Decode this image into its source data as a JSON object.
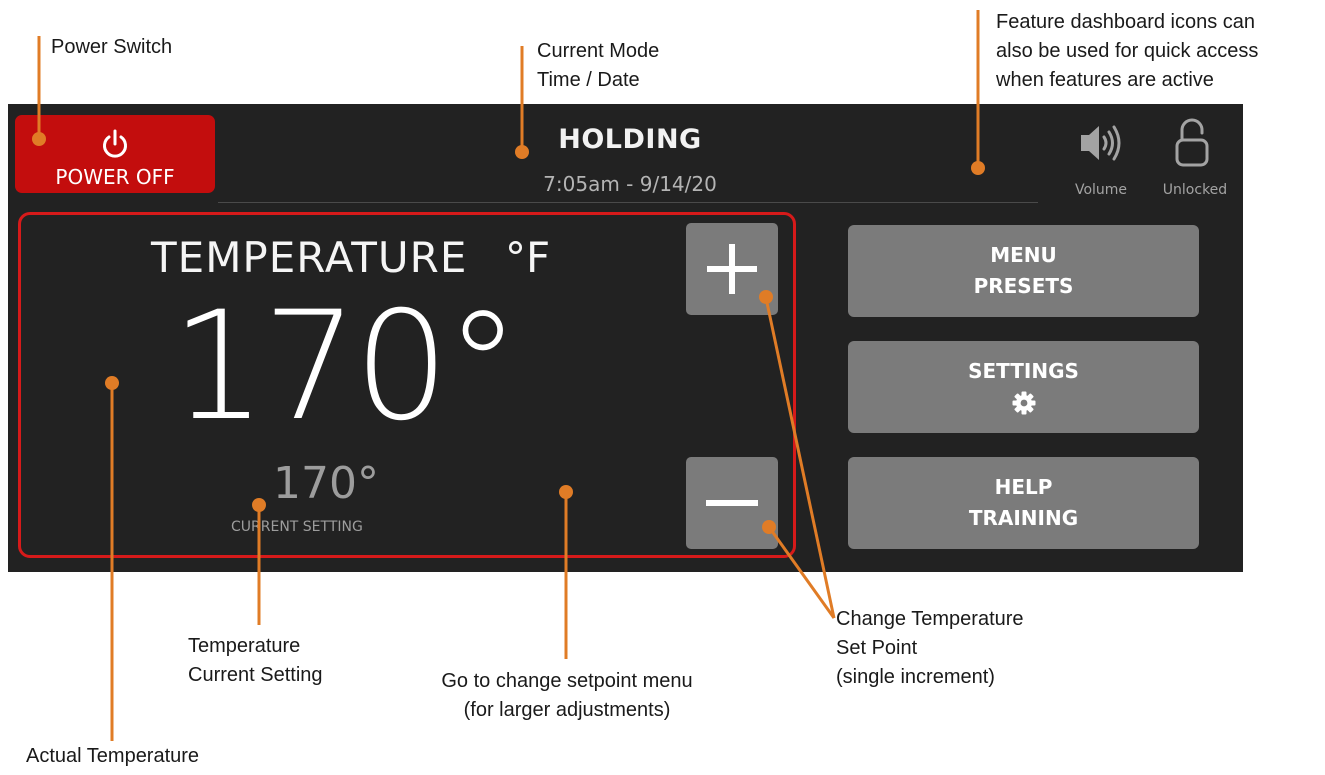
{
  "callouts": {
    "power_switch": "Power Switch",
    "current_mode": [
      "Current Mode",
      "Time / Date"
    ],
    "dashboard_icons": [
      "Feature dashboard icons can",
      "also be used for quick access",
      "when features are active"
    ],
    "current_setting": [
      "Temperature",
      "Current Setting"
    ],
    "setpoint_menu": [
      "Go to change setpoint menu",
      "(for larger adjustments)"
    ],
    "change_setpoint": [
      "Change Temperature",
      "Set Point",
      "(single increment)"
    ],
    "actual_temperature": "Actual Temperature"
  },
  "screen": {
    "power_button": {
      "label": "POWER OFF",
      "icon": "power-icon"
    },
    "mode": "HOLDING",
    "datetime": "7:05am - 9/14/20",
    "dashboard": {
      "volume": {
        "label": "Volume",
        "icon": "speaker-volume-icon"
      },
      "lock": {
        "label": "Unlocked",
        "icon": "padlock-open-icon"
      }
    },
    "temperature": {
      "title": "TEMPERATURE",
      "unit": "°F",
      "actual": "170°",
      "setpoint": "170°",
      "setpoint_label": "CURRENT SETTING"
    },
    "increment": {
      "icon": "plus-icon"
    },
    "decrement": {
      "icon": "minus-icon"
    },
    "menu_presets": [
      "MENU",
      "PRESETS"
    ],
    "settings": {
      "label": "SETTINGS",
      "icon": "gear-icon"
    },
    "help_training": [
      "HELP",
      "TRAINING"
    ]
  },
  "colors": {
    "callout_line": "#e07c26",
    "power_button": "#c30d0d",
    "panel_border": "#d61a1a",
    "screen_background": "#222222",
    "button_gray": "#7b7b7b"
  }
}
